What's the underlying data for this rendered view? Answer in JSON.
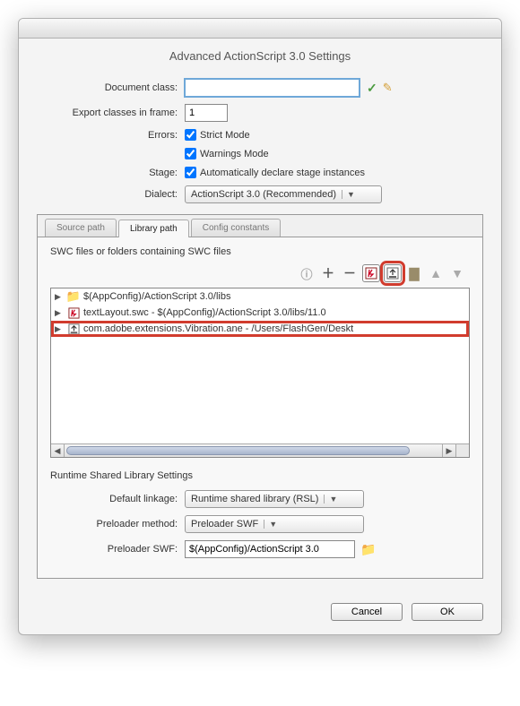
{
  "title": "Advanced ActionScript 3.0 Settings",
  "form": {
    "document_class_label": "Document class:",
    "document_class_value": "",
    "export_frame_label": "Export classes in frame:",
    "export_frame_value": "1",
    "errors_label": "Errors:",
    "strict_mode_label": "Strict Mode",
    "warnings_mode_label": "Warnings Mode",
    "stage_label": "Stage:",
    "stage_checkbox_label": "Automatically declare stage instances",
    "dialect_label": "Dialect:",
    "dialect_value": "ActionScript 3.0 (Recommended)"
  },
  "tabs": {
    "source_path": "Source path",
    "library_path": "Library path",
    "config_constants": "Config constants"
  },
  "library_panel": {
    "group_label": "SWC files or folders containing SWC files",
    "tree": [
      {
        "icon": "folder",
        "label": "$(AppConfig)/ActionScript 3.0/libs"
      },
      {
        "icon": "flash",
        "label": "textLayout.swc - $(AppConfig)/ActionScript 3.0/libs/11.0"
      },
      {
        "icon": "native",
        "label": "com.adobe.extensions.Vibration.ane - /Users/FlashGen/Deskt"
      }
    ]
  },
  "runtime": {
    "section_label": "Runtime Shared Library Settings",
    "default_linkage_label": "Default linkage:",
    "default_linkage_value": "Runtime shared library (RSL)",
    "preloader_method_label": "Preloader method:",
    "preloader_method_value": "Preloader SWF",
    "preloader_swf_label": "Preloader SWF:",
    "preloader_swf_value": "$(AppConfig)/ActionScript 3.0"
  },
  "buttons": {
    "cancel": "Cancel",
    "ok": "OK"
  }
}
